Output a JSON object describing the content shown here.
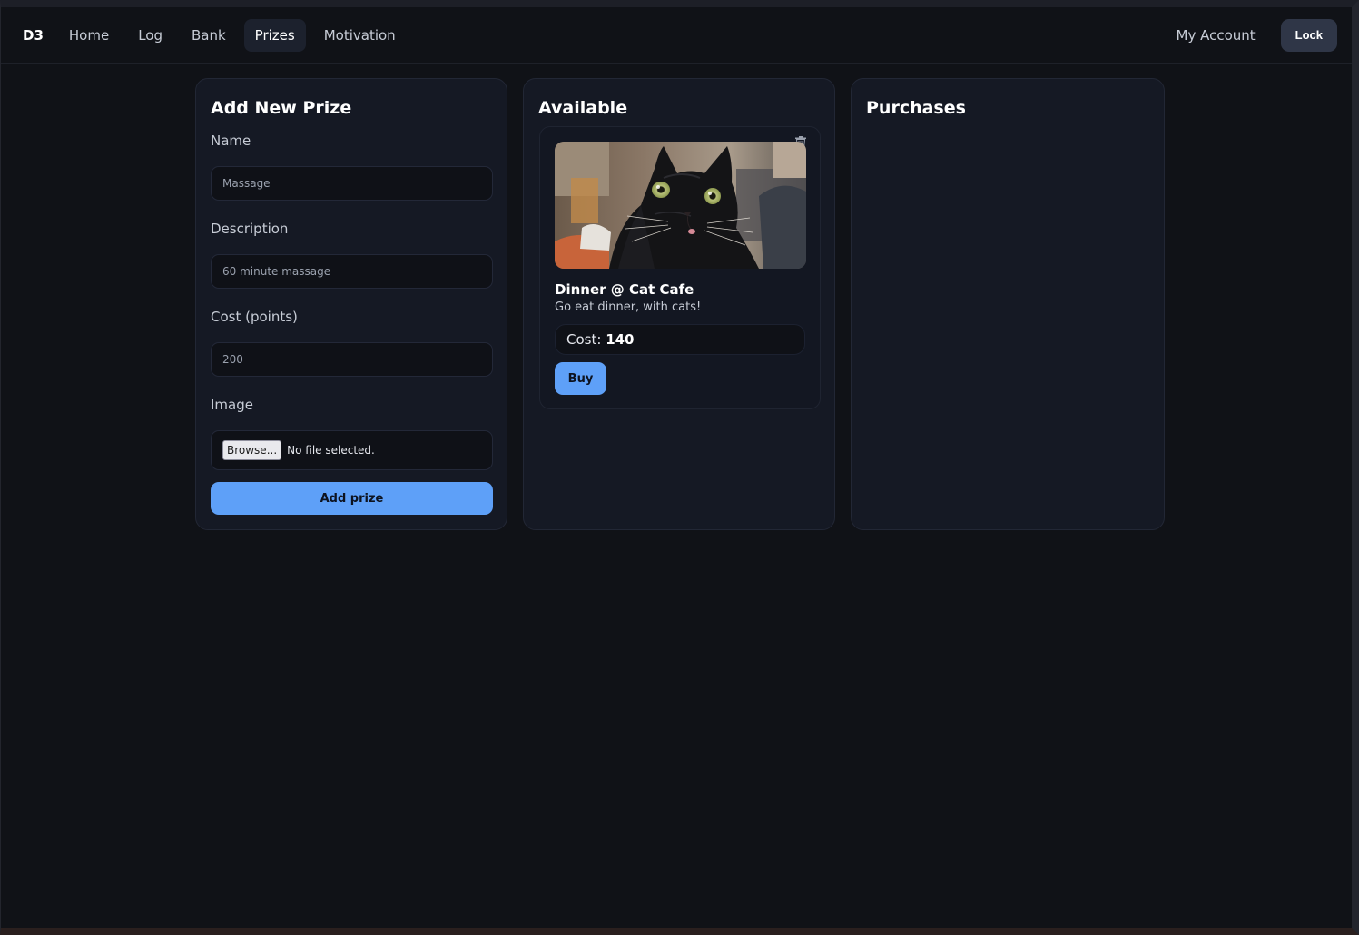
{
  "nav": {
    "brand": "D3",
    "items": [
      {
        "label": "Home",
        "active": false
      },
      {
        "label": "Log",
        "active": false
      },
      {
        "label": "Bank",
        "active": false
      },
      {
        "label": "Prizes",
        "active": true
      },
      {
        "label": "Motivation",
        "active": false
      }
    ],
    "account_label": "My Account",
    "lock_label": "Lock"
  },
  "add_prize": {
    "title": "Add New Prize",
    "name_label": "Name",
    "name_placeholder": "Massage",
    "description_label": "Description",
    "description_placeholder": "60 minute massage",
    "cost_label": "Cost (points)",
    "cost_placeholder": "200",
    "image_label": "Image",
    "browse_label": "Browse...",
    "file_status": "No file selected.",
    "submit_label": "Add prize"
  },
  "available": {
    "title": "Available",
    "prizes": [
      {
        "name": "Dinner @ Cat Cafe",
        "description": "Go eat dinner, with cats!",
        "cost_label": "Cost:",
        "cost_value": "140",
        "buy_label": "Buy",
        "image_icon": "black-cat-photo",
        "delete_icon": "trash-icon"
      }
    ]
  },
  "purchases": {
    "title": "Purchases",
    "items": []
  },
  "colors": {
    "background": "#101217",
    "panel": "#151924",
    "accent": "#5ea0f8",
    "lock_button": "#2f3647"
  }
}
